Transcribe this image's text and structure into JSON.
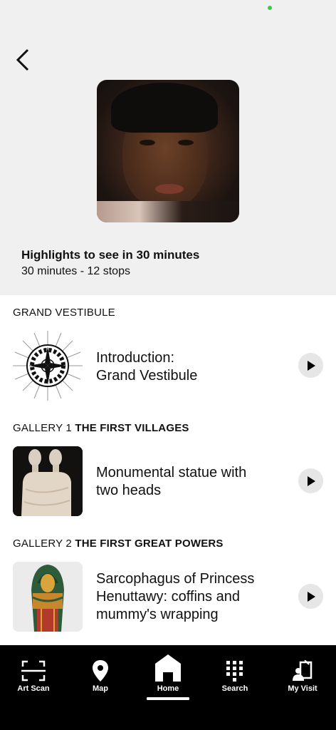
{
  "tour": {
    "title": "Highlights to see in 30 minutes",
    "meta": "30 minutes - 12 stops"
  },
  "sections": [
    {
      "prefix": "GRAND VESTIBULE",
      "bold": ""
    },
    {
      "prefix": "GALLERY 1 ",
      "bold": "THE FIRST VILLAGES"
    },
    {
      "prefix": "GALLERY 2 ",
      "bold": "THE FIRST GREAT POWERS"
    }
  ],
  "stops": [
    {
      "line1": "Introduction:",
      "line2": "Grand Vestibule",
      "line3": ""
    },
    {
      "line1": "Monumental statue with",
      "line2": "two heads",
      "line3": ""
    },
    {
      "line1": "Sarcophagus of Princess",
      "line2": "Henuttawy: coffins and",
      "line3": "mummy's wrapping"
    }
  ],
  "tabs": [
    {
      "label": "Art Scan",
      "icon": "scan-icon"
    },
    {
      "label": "Map",
      "icon": "map-pin-icon"
    },
    {
      "label": "Home",
      "icon": "home-icon",
      "active": true
    },
    {
      "label": "Search",
      "icon": "keypad-icon"
    },
    {
      "label": "My Visit",
      "icon": "my-visit-icon"
    }
  ],
  "colors": {
    "header_bg": "#f0f0f0",
    "tab_bar_bg": "#000000",
    "play_bg": "#e6e6e6",
    "status_dot": "#3ec84c"
  }
}
